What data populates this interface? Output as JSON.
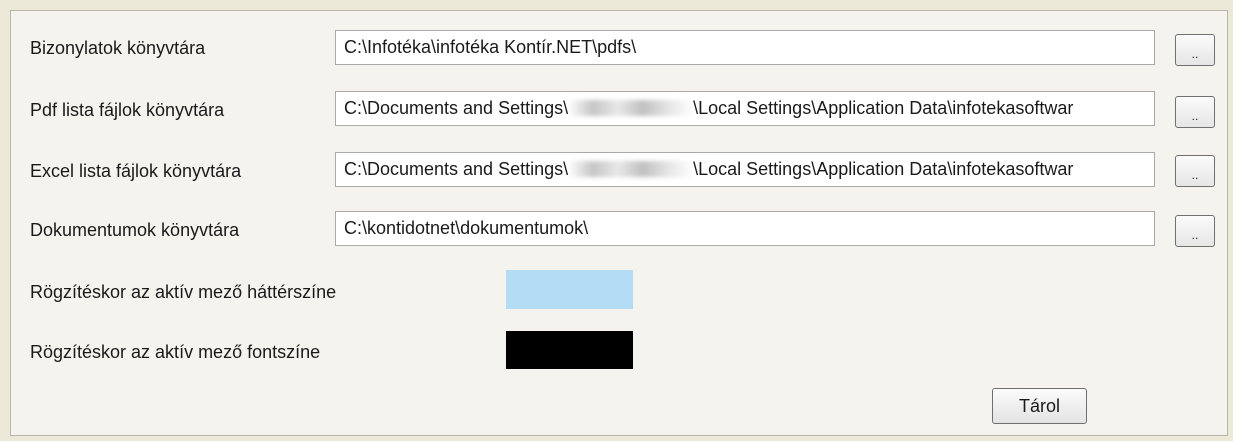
{
  "settings": {
    "rows": [
      {
        "label": "Bizonylatok könyvtára",
        "value": "C:\\Infotéka\\infotéka Kontír.NET\\pdfs\\",
        "browse": ".."
      },
      {
        "label": "Pdf lista fájlok könyvtára",
        "value_prefix": "C:\\Documents and Settings\\",
        "value_suffix": "\\Local Settings\\Application Data\\infotekasoftwar",
        "browse": ".."
      },
      {
        "label": "Excel lista fájlok könyvtára",
        "value_prefix": "C:\\Documents and Settings\\",
        "value_suffix": "\\Local Settings\\Application Data\\infotekasoftwar",
        "browse": ".."
      },
      {
        "label": "Dokumentumok könyvtára",
        "value": "C:\\kontidotnet\\dokumentumok\\",
        "browse": ".."
      }
    ],
    "active_bg": {
      "label": "Rögzítéskor az aktív mező háttérszíne",
      "color": "#b4dcf5"
    },
    "active_font": {
      "label": "Rögzítéskor az aktív mező fontszíne",
      "color": "#000000"
    }
  },
  "save_label": "Tárol"
}
